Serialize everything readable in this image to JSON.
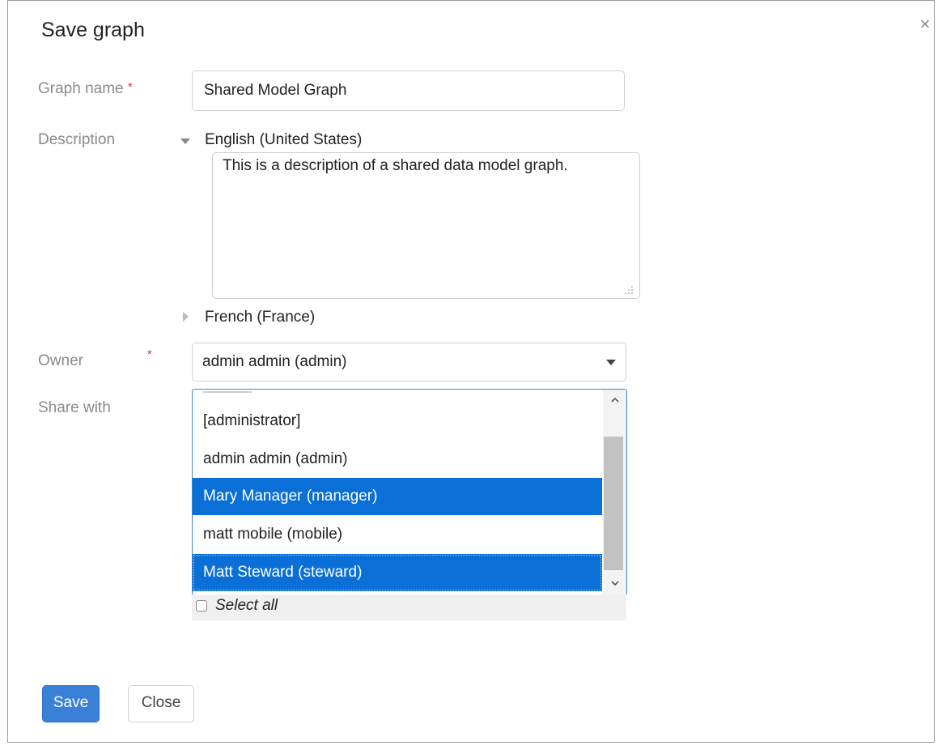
{
  "dialog": {
    "title": "Save graph",
    "close_glyph": "×"
  },
  "form": {
    "graph_name": {
      "label": "Graph name",
      "required_mark": "*",
      "value": "Shared Model Graph"
    },
    "description": {
      "label": "Description",
      "languages": [
        {
          "name": "English (United States)",
          "expanded": true,
          "value": "This is a description of a shared data model graph."
        },
        {
          "name": "French (France)",
          "expanded": false
        }
      ]
    },
    "owner": {
      "label": "Owner",
      "required_mark": "*",
      "value": "admin admin (admin)"
    },
    "share_with": {
      "label": "Share with",
      "options": [
        {
          "label": "[administrator]",
          "selected": false
        },
        {
          "label": "admin admin (admin)",
          "selected": false
        },
        {
          "label": "Mary Manager (manager)",
          "selected": true
        },
        {
          "label": "matt mobile (mobile)",
          "selected": false
        },
        {
          "label": "Matt Steward (steward)",
          "selected": true
        }
      ],
      "select_all_label": "Select all",
      "select_all_checked": false
    }
  },
  "buttons": {
    "save": "Save",
    "close": "Close"
  },
  "colors": {
    "primary": "#3a7fd8",
    "selected_option": "#0a6fd6",
    "required": "#d9342b",
    "label": "#8a8a8a"
  },
  "icons": [
    "close-icon",
    "triangle-down-icon",
    "triangle-right-icon",
    "chevron-down-icon",
    "chevron-up-icon",
    "resize-grip-icon"
  ]
}
